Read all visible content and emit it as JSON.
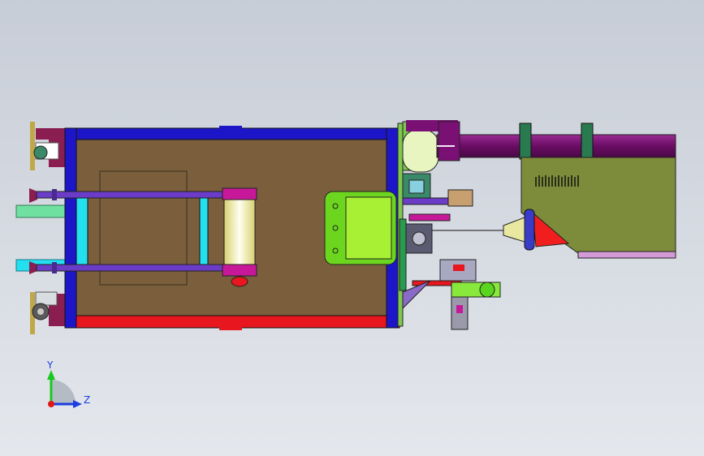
{
  "viewport": {
    "background_top": "#c7cdd7",
    "background_bottom": "#e4e7ec"
  },
  "triad": {
    "y_label": "Y",
    "z_label": "Z",
    "y_color": "#19c81e",
    "z_color": "#1a3ee0",
    "origin_color": "#e01616"
  },
  "colors": {
    "frame_fill": "#7b5f3d",
    "frame_top_rail": "#1d16c8",
    "frame_bottom_rail": "#e8161e",
    "frame_left_rail": "#1d16c8",
    "frame_right_rail": "#1d16c8",
    "rod": "#6b3cc8",
    "cyan_block": "#22e0f0",
    "roller": "#f3f3a0",
    "roller_cap": "#c8189a",
    "green_plate": "#6cd61e",
    "lime_panel": "#a8f033",
    "purple_pipe": "#7a1074",
    "olive_housing": "#7d8c3a",
    "red_cone": "#f01e1e",
    "mint_bar": "#6fe0a0",
    "pale_cylinder": "#e8f5c0"
  }
}
